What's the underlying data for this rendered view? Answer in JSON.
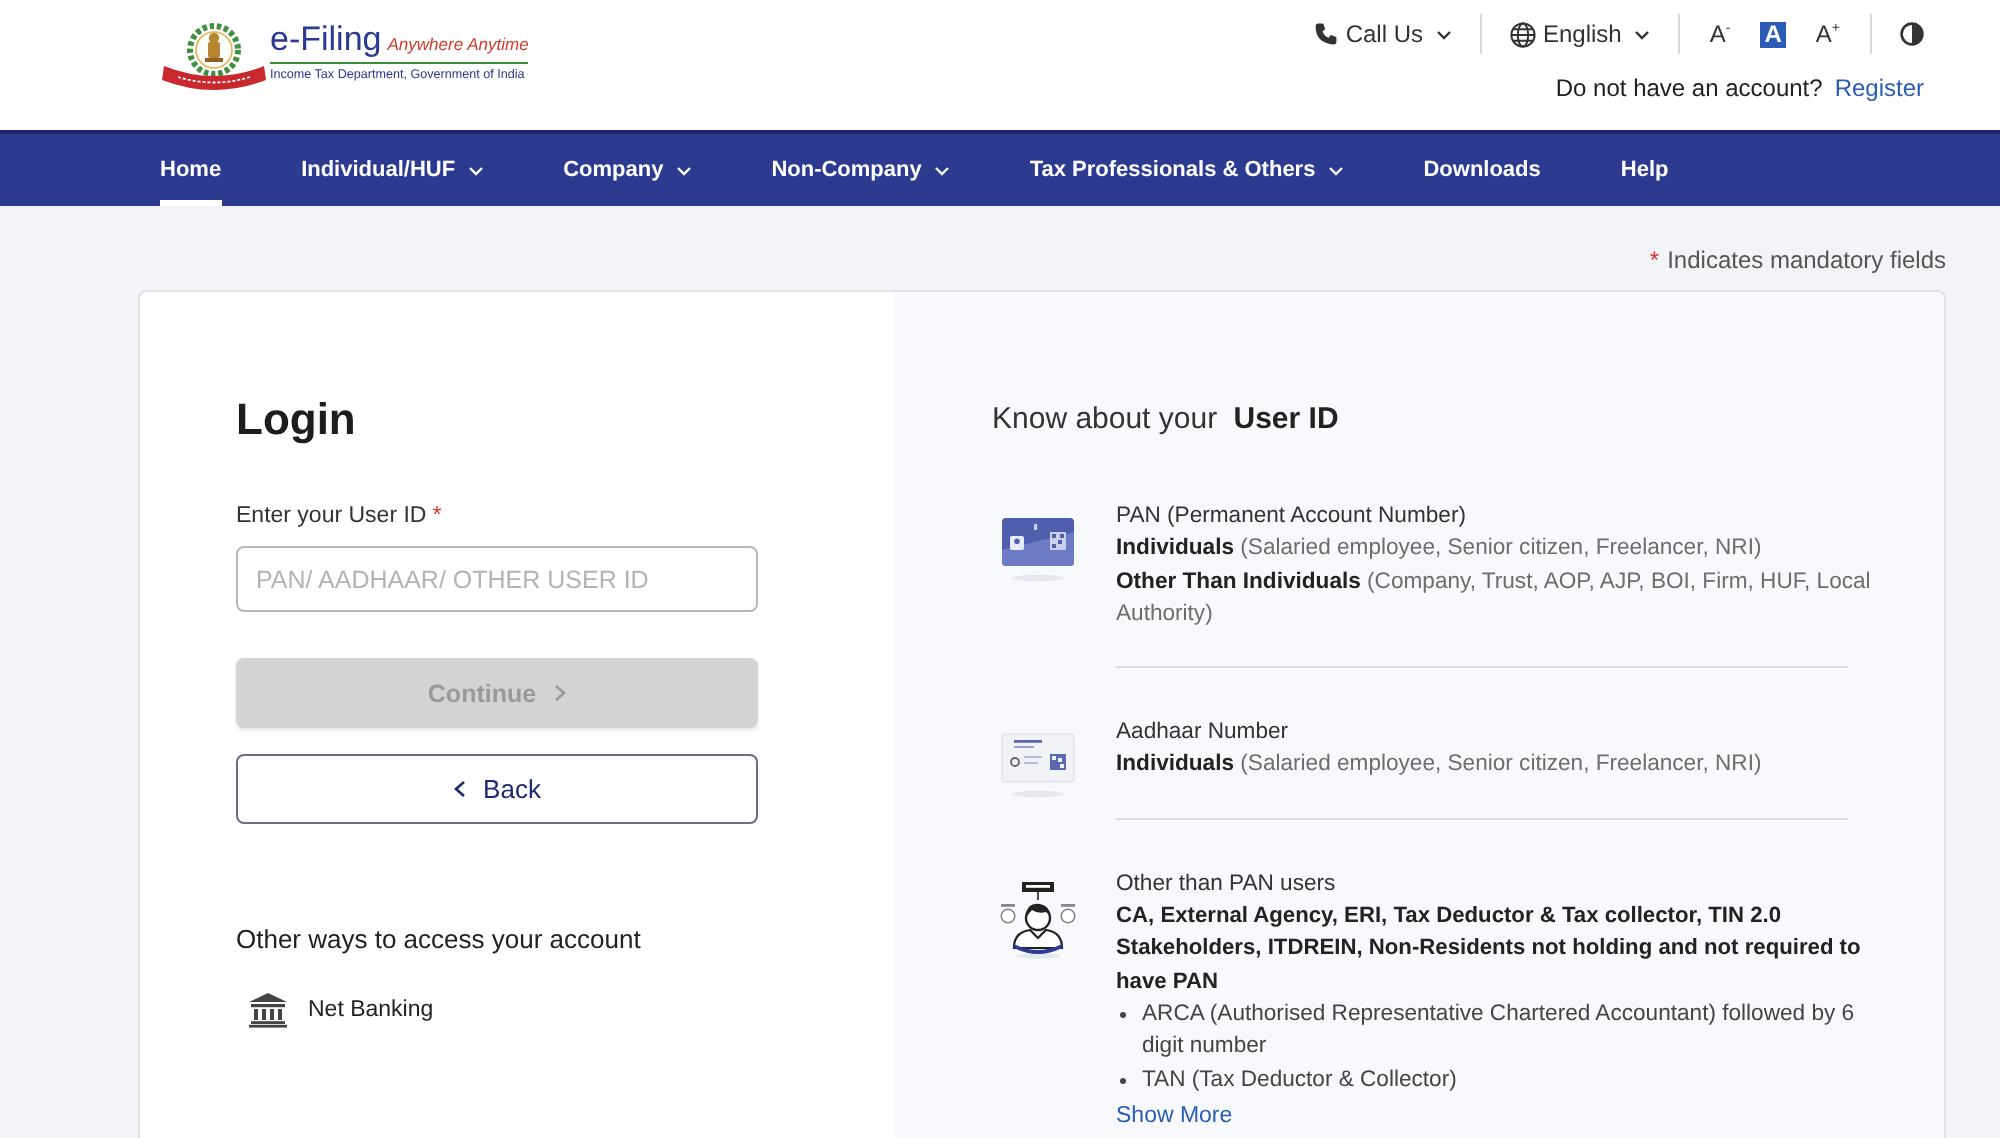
{
  "header": {
    "logo": {
      "title": "e-Filing",
      "tagline": "Anywhere Anytime",
      "subtitle": "Income Tax Department, Government of India"
    },
    "menus": [
      {
        "kind": "phone",
        "label": "Call Us"
      },
      {
        "kind": "language",
        "label": "English"
      }
    ],
    "font_sizes": [
      {
        "label": "A$^{-}$",
        "selected": false
      },
      {
        "label": "A",
        "selected": true
      },
      {
        "label": "A$^{+}$",
        "selected": false
      }
    ],
    "account_prompt": "Do not have an account?",
    "register_link": "Register"
  },
  "nav": {
    "items": [
      {
        "label": "Home",
        "selected": true,
        "has_menu": false
      },
      {
        "label": "Individual/HUF",
        "selected": false,
        "has_menu": true
      },
      {
        "label": "Company",
        "selected": false,
        "has_menu": true
      },
      {
        "label": "Non-Company",
        "selected": false,
        "has_menu": true
      },
      {
        "label": "Tax Professionals & Others",
        "selected": false,
        "has_menu": true
      },
      {
        "label": "Downloads",
        "selected": false,
        "has_menu": false
      },
      {
        "label": "Help",
        "selected": false,
        "has_menu": false
      }
    ]
  },
  "mandatory_note": {
    "mark": "*",
    "text": "Indicates mandatory fields"
  },
  "login": {
    "title": "Login",
    "field": {
      "label": "Enter your User ID",
      "required_mark": "*",
      "placeholder": "PAN/ AADHAAR/ OTHER USER ID"
    },
    "buttons": [
      {
        "kind": "next",
        "label": "Continue",
        "disabled": true
      },
      {
        "kind": "back",
        "label": "Back",
        "disabled": false
      }
    ],
    "other_access": {
      "heading": "Other ways to access your account",
      "options": [
        {
          "kind": "bank",
          "label": "Net Banking"
        }
      ]
    }
  },
  "user_id_info": {
    "title": "Know about your **User ID**",
    "items": [
      {
        "kind": "pan",
        "title": "PAN (Permanent Account Number)",
        "lines": [
          "**Individuals** (Salaried employee, Senior citizen, Freelancer, NRI)",
          "**Other Than Individuals** (Company, Trust, AOP, AJP, BOI, Firm, HUF, Local Authority)"
        ]
      },
      {
        "kind": "aadhaar",
        "title": "Aadhaar Number",
        "lines": [
          "**Individuals** (Salaried employee, Senior citizen, Freelancer, NRI)"
        ]
      },
      {
        "kind": "other",
        "title": "Other than PAN users",
        "description": "CA, External Agency, ERI, Tax Deductor & Tax collector, TIN 2.0 Stakeholders, ITDREIN, Non-Residents not holding and not required to have PAN",
        "bullets": [
          "ARCA (Authorised Representative Chartered Accountant) followed by 6 digit number",
          "TAN (Tax Deductor & Collector)"
        ]
      }
    ],
    "show_more": "Show More"
  }
}
